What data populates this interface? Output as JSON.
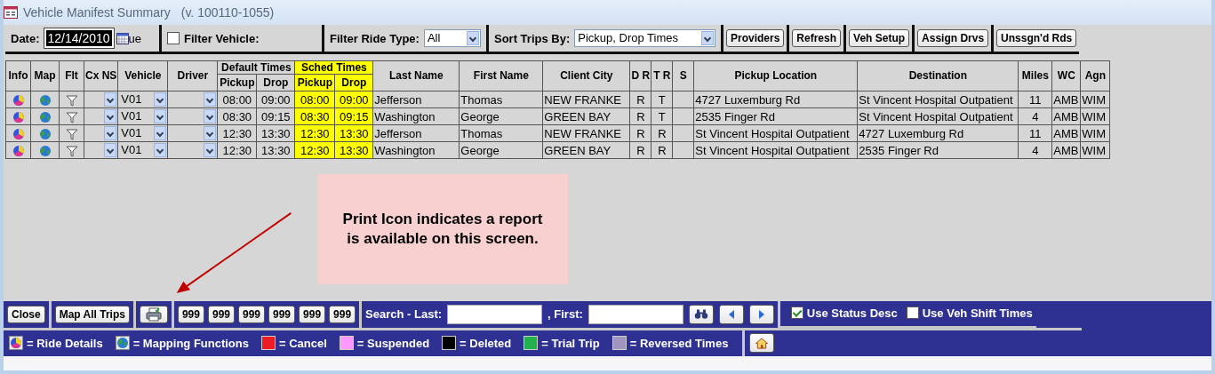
{
  "window": {
    "title": "Vehicle Manifest Summary",
    "version": "(v. 100110-1055)"
  },
  "toolbar": {
    "date_label": "Date:",
    "date": "12/14/2010",
    "day": "ue",
    "filter_vehicle": {
      "label": "Filter Vehicle:",
      "checked": false
    },
    "filter_ride_type": {
      "label": "Filter Ride Type:",
      "value": "All"
    },
    "sort": {
      "label": "Sort Trips By:",
      "value": "Pickup, Drop Times"
    },
    "buttons": [
      "Providers",
      "Refresh",
      "Veh Setup",
      "Assign Drvs",
      "Unssgn'd Rds"
    ]
  },
  "table": {
    "columns": [
      {
        "label": "Info"
      },
      {
        "label": "Map"
      },
      {
        "label": "Flt"
      },
      {
        "label": "Cx NS"
      },
      {
        "label": "Vehicle"
      },
      {
        "label": "Driver"
      },
      {
        "label": "Default Times",
        "highlighted": false,
        "sub": [
          "Pickup",
          "Drop"
        ]
      },
      {
        "label": "Sched Times",
        "highlighted": true,
        "sub": [
          "Pickup",
          "Drop"
        ]
      },
      {
        "label": "Last Name"
      },
      {
        "label": "First Name"
      },
      {
        "label": "Client City"
      },
      {
        "label": "D R"
      },
      {
        "label": "T R"
      },
      {
        "label": "S"
      },
      {
        "label": "Pickup Location"
      },
      {
        "label": "Destination"
      },
      {
        "label": "Miles"
      },
      {
        "label": "WC"
      },
      {
        "label": "Agn"
      }
    ],
    "rows": [
      {
        "vehicle": "V01",
        "default_pickup": "08:00",
        "default_drop": "09:00",
        "sched_pickup": "08:00",
        "sched_drop": "09:00",
        "last_name": "Jefferson",
        "first_name": "Thomas",
        "client_city": "NEW FRANKE",
        "dr": "R",
        "tr": "T",
        "pickup_location": "4727 Luxemburg Rd",
        "destination": "St Vincent Hospital Outpatient",
        "miles": "11",
        "wc": "AMB",
        "agn": "WIM"
      },
      {
        "vehicle": "V01",
        "default_pickup": "08:30",
        "default_drop": "09:15",
        "sched_pickup": "08:30",
        "sched_drop": "09:15",
        "last_name": "Washington",
        "first_name": "George",
        "client_city": "GREEN BAY",
        "dr": "R",
        "tr": "T",
        "pickup_location": "2535 Finger Rd",
        "destination": "St Vincent Hospital Outpatient",
        "miles": "4",
        "wc": "AMB",
        "agn": "WIM"
      },
      {
        "vehicle": "V01",
        "default_pickup": "12:30",
        "default_drop": "13:30",
        "sched_pickup": "12:30",
        "sched_drop": "13:30",
        "last_name": "Jefferson",
        "first_name": "Thomas",
        "client_city": "NEW FRANKE",
        "dr": "R",
        "tr": "R",
        "pickup_location": "St Vincent Hospital Outpatient",
        "destination": "4727 Luxemburg Rd",
        "miles": "11",
        "wc": "AMB",
        "agn": "WIM"
      },
      {
        "vehicle": "V01",
        "default_pickup": "12:30",
        "default_drop": "13:30",
        "sched_pickup": "12:30",
        "sched_drop": "13:30",
        "last_name": "Washington",
        "first_name": "George",
        "client_city": "GREEN BAY",
        "dr": "R",
        "tr": "R",
        "pickup_location": "St Vincent Hospital Outpatient",
        "destination": "2535 Finger Rd",
        "miles": "4",
        "wc": "AMB",
        "agn": "WIM"
      }
    ]
  },
  "callout": "Print Icon indicates a report is available on this screen.",
  "bottom_bar": {
    "buttons": [
      "Close",
      "Map All Trips"
    ],
    "counters": [
      "999",
      "999",
      "999",
      "999",
      "999",
      "999"
    ],
    "search_last_label": "Search - Last:",
    "search_first_label": ", First:",
    "options": [
      {
        "label": "Use Status Desc",
        "checked": true
      },
      {
        "label": "Use Veh Shift Times",
        "checked": false
      }
    ]
  },
  "legend": [
    {
      "kind": "info",
      "label": "= Ride Details"
    },
    {
      "kind": "globe",
      "label": "= Mapping Functions"
    },
    {
      "kind": "swatch",
      "color": "#ed1c24",
      "label": "= Cancel"
    },
    {
      "kind": "swatch",
      "color": "#ff99ff",
      "label": "= Suspended"
    },
    {
      "kind": "swatch",
      "color": "#000000",
      "label": "= Deleted"
    },
    {
      "kind": "swatch",
      "color": "#22b14c",
      "label": "= Trial Trip"
    },
    {
      "kind": "swatch",
      "color": "#a095c0",
      "label": "= Reversed Times"
    }
  ]
}
